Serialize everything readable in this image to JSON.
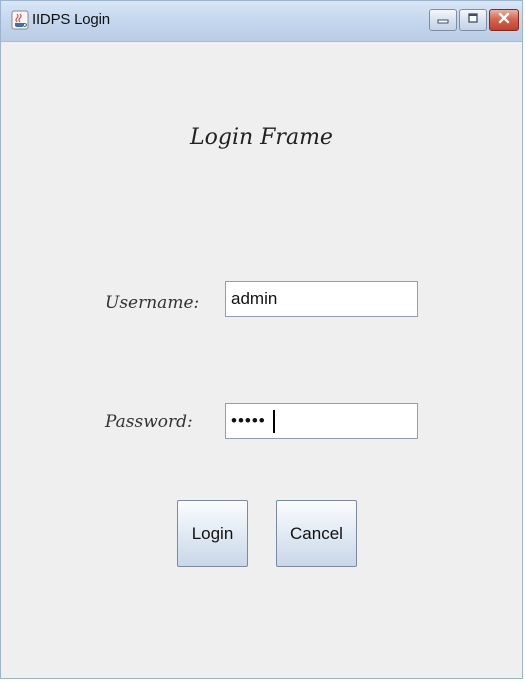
{
  "window": {
    "title": "IIDPS Login",
    "app_icon": "java-cup-icon",
    "controls": {
      "minimize_icon": "minimize-icon",
      "maximize_icon": "maximize-icon",
      "close_icon": "close-icon"
    }
  },
  "form": {
    "heading": "Login Frame",
    "username_label": "Username:",
    "username_value": "admin",
    "password_label": "Password:",
    "password_value": "•••••",
    "login_label": "Login",
    "cancel_label": "Cancel"
  },
  "colors": {
    "background": "#efefef",
    "titlebar": "#c6d8ee",
    "close_button": "#c0402b"
  }
}
